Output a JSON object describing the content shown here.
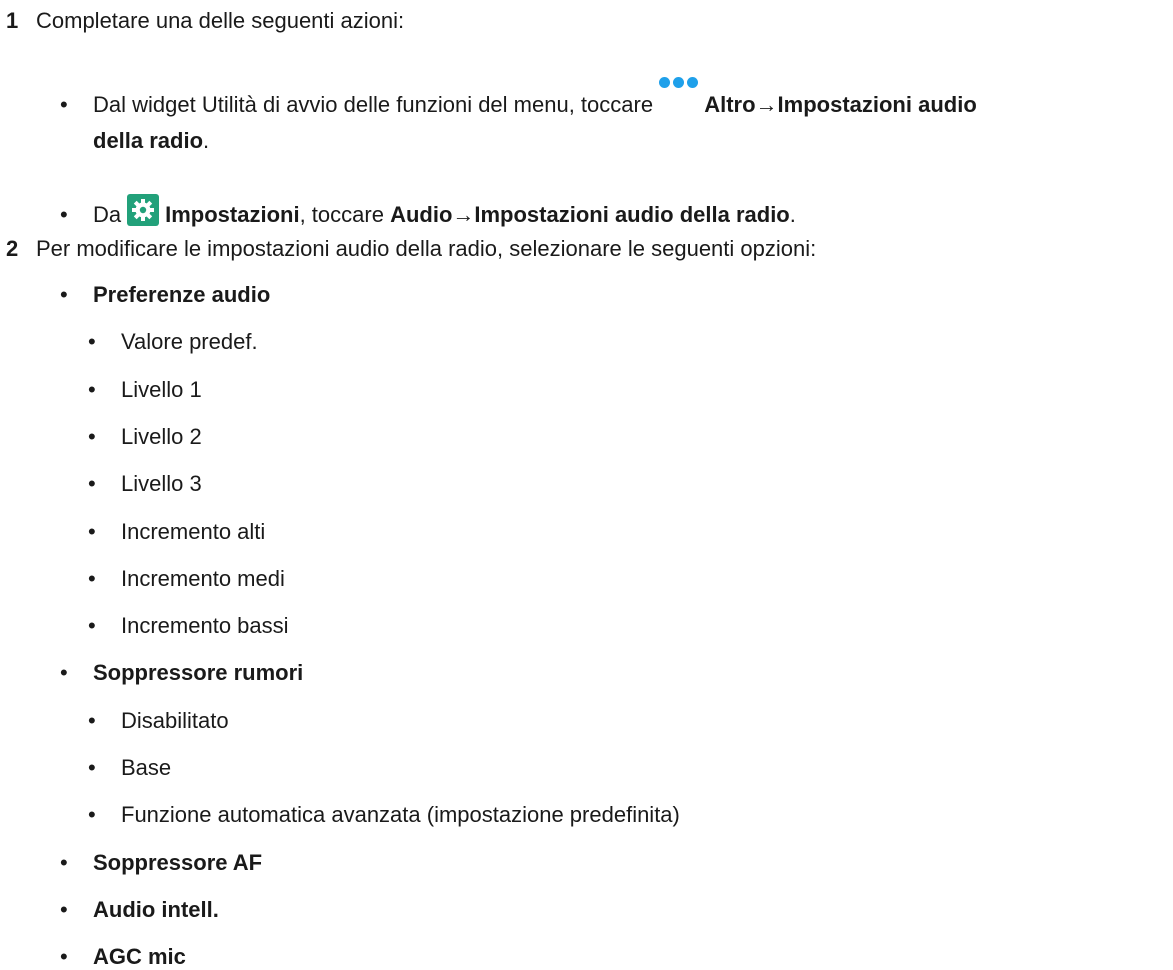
{
  "step1": {
    "number": "1",
    "text": "Completare una delle seguenti azioni:",
    "option_a": {
      "lead": "Dal widget Utilità di avvio delle funzioni del menu, toccare",
      "bold1": "Altro→Impostazioni audio",
      "bold2": "della radio",
      "tail": ".",
      "icon": "more-dots-icon",
      "icon_color": "#1fa0ea"
    },
    "option_b": {
      "lead": "Da",
      "icon": "settings-gear-icon",
      "icon_color": "#22a17a",
      "bold1": "Impostazioni",
      "mid": ", toccare ",
      "bold2": "Audio→Impostazioni audio della radio",
      "tail": "."
    }
  },
  "step2": {
    "number": "2",
    "text": "Per modificare le impostazioni audio della radio, selezionare le seguenti opzioni:",
    "groups": [
      {
        "title": "Preferenze audio",
        "items": [
          "Valore predef.",
          "Livello 1",
          "Livello 2",
          "Livello 3",
          "Incremento alti",
          "Incremento medi",
          "Incremento bassi"
        ]
      },
      {
        "title": "Soppressore rumori",
        "items": [
          "Disabilitato",
          "Base",
          "Funzione automatica avanzata (impostazione predefinita)"
        ]
      },
      {
        "title": "Soppressore AF",
        "items": []
      },
      {
        "title": "Audio intell.",
        "items": []
      },
      {
        "title": "AGC mic",
        "items": []
      }
    ]
  },
  "bullet": "•"
}
